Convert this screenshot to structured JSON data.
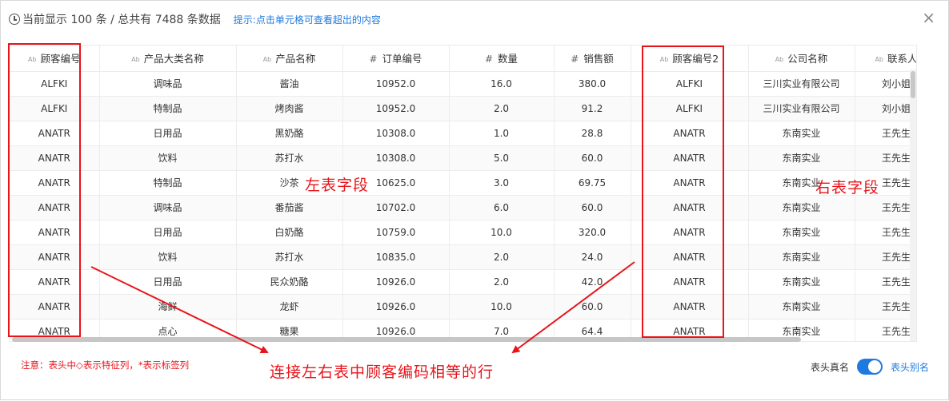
{
  "header": {
    "count_text": "当前显示 100 条 / 总共有 7488 条数据",
    "hint_text": "提示:点击单元格可查看超出的内容",
    "close_glyph": "×"
  },
  "columns": [
    {
      "label": "顾客编号",
      "type": "Ab"
    },
    {
      "label": "产品大类名称",
      "type": "Ab"
    },
    {
      "label": "产品名称",
      "type": "Ab"
    },
    {
      "label": "订单编号",
      "type": "#"
    },
    {
      "label": "数量",
      "type": "#"
    },
    {
      "label": "销售额",
      "type": "#"
    },
    {
      "label": "顾客编号2",
      "type": "Ab"
    },
    {
      "label": "公司名称",
      "type": "Ab"
    },
    {
      "label": "联系人",
      "type": "Ab"
    }
  ],
  "rows": [
    [
      "ALFKI",
      "调味品",
      "酱油",
      "10952.0",
      "16.0",
      "380.0",
      "ALFKI",
      "三川实业有限公司",
      "刘小姐"
    ],
    [
      "ALFKI",
      "特制品",
      "烤肉酱",
      "10952.0",
      "2.0",
      "91.2",
      "ALFKI",
      "三川实业有限公司",
      "刘小姐"
    ],
    [
      "ANATR",
      "日用品",
      "黑奶酪",
      "10308.0",
      "1.0",
      "28.8",
      "ANATR",
      "东南实业",
      "王先生"
    ],
    [
      "ANATR",
      "饮料",
      "苏打水",
      "10308.0",
      "5.0",
      "60.0",
      "ANATR",
      "东南实业",
      "王先生"
    ],
    [
      "ANATR",
      "特制品",
      "沙茶",
      "10625.0",
      "3.0",
      "69.75",
      "ANATR",
      "东南实业",
      "王先生"
    ],
    [
      "ANATR",
      "调味品",
      "番茄酱",
      "10702.0",
      "6.0",
      "60.0",
      "ANATR",
      "东南实业",
      "王先生"
    ],
    [
      "ANATR",
      "日用品",
      "白奶酪",
      "10759.0",
      "10.0",
      "320.0",
      "ANATR",
      "东南实业",
      "王先生"
    ],
    [
      "ANATR",
      "饮料",
      "苏打水",
      "10835.0",
      "2.0",
      "24.0",
      "ANATR",
      "东南实业",
      "王先生"
    ],
    [
      "ANATR",
      "日用品",
      "民众奶酪",
      "10926.0",
      "2.0",
      "42.0",
      "ANATR",
      "东南实业",
      "王先生"
    ],
    [
      "ANATR",
      "海鲜",
      "龙虾",
      "10926.0",
      "10.0",
      "60.0",
      "ANATR",
      "东南实业",
      "王先生"
    ],
    [
      "ANATR",
      "点心",
      "糖果",
      "10926.0",
      "7.0",
      "64.4",
      "ANATR",
      "东南实业",
      "王先生"
    ]
  ],
  "annotations": {
    "left_label": "左表字段",
    "right_label": "右表字段",
    "bottom_label": "连接左右表中顾客编码相等的行"
  },
  "footer": {
    "note": "注意：表头中◇表示特征列，*表示标签列",
    "toggle_off_label": "表头真名",
    "toggle_on_label": "表头别名",
    "toggle_on": true
  },
  "colors": {
    "accent": "#1f7ae0",
    "annotation_red": "#e8141a"
  }
}
